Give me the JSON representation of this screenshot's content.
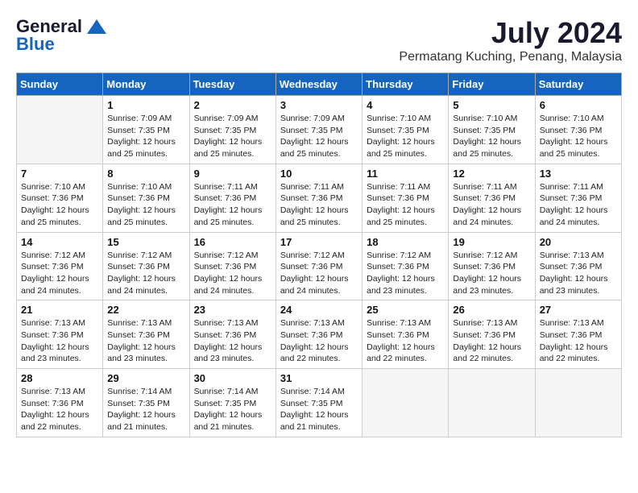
{
  "header": {
    "logo_general": "General",
    "logo_blue": "Blue",
    "month_year": "July 2024",
    "location": "Permatang Kuching, Penang, Malaysia"
  },
  "weekdays": [
    "Sunday",
    "Monday",
    "Tuesday",
    "Wednesday",
    "Thursday",
    "Friday",
    "Saturday"
  ],
  "weeks": [
    [
      {
        "day": "",
        "empty": true
      },
      {
        "day": "1",
        "sunrise": "7:09 AM",
        "sunset": "7:35 PM",
        "daylight": "12 hours and 25 minutes."
      },
      {
        "day": "2",
        "sunrise": "7:09 AM",
        "sunset": "7:35 PM",
        "daylight": "12 hours and 25 minutes."
      },
      {
        "day": "3",
        "sunrise": "7:09 AM",
        "sunset": "7:35 PM",
        "daylight": "12 hours and 25 minutes."
      },
      {
        "day": "4",
        "sunrise": "7:10 AM",
        "sunset": "7:35 PM",
        "daylight": "12 hours and 25 minutes."
      },
      {
        "day": "5",
        "sunrise": "7:10 AM",
        "sunset": "7:35 PM",
        "daylight": "12 hours and 25 minutes."
      },
      {
        "day": "6",
        "sunrise": "7:10 AM",
        "sunset": "7:36 PM",
        "daylight": "12 hours and 25 minutes."
      }
    ],
    [
      {
        "day": "7",
        "sunrise": "7:10 AM",
        "sunset": "7:36 PM",
        "daylight": "12 hours and 25 minutes."
      },
      {
        "day": "8",
        "sunrise": "7:10 AM",
        "sunset": "7:36 PM",
        "daylight": "12 hours and 25 minutes."
      },
      {
        "day": "9",
        "sunrise": "7:11 AM",
        "sunset": "7:36 PM",
        "daylight": "12 hours and 25 minutes."
      },
      {
        "day": "10",
        "sunrise": "7:11 AM",
        "sunset": "7:36 PM",
        "daylight": "12 hours and 25 minutes."
      },
      {
        "day": "11",
        "sunrise": "7:11 AM",
        "sunset": "7:36 PM",
        "daylight": "12 hours and 25 minutes."
      },
      {
        "day": "12",
        "sunrise": "7:11 AM",
        "sunset": "7:36 PM",
        "daylight": "12 hours and 24 minutes."
      },
      {
        "day": "13",
        "sunrise": "7:11 AM",
        "sunset": "7:36 PM",
        "daylight": "12 hours and 24 minutes."
      }
    ],
    [
      {
        "day": "14",
        "sunrise": "7:12 AM",
        "sunset": "7:36 PM",
        "daylight": "12 hours and 24 minutes."
      },
      {
        "day": "15",
        "sunrise": "7:12 AM",
        "sunset": "7:36 PM",
        "daylight": "12 hours and 24 minutes."
      },
      {
        "day": "16",
        "sunrise": "7:12 AM",
        "sunset": "7:36 PM",
        "daylight": "12 hours and 24 minutes."
      },
      {
        "day": "17",
        "sunrise": "7:12 AM",
        "sunset": "7:36 PM",
        "daylight": "12 hours and 24 minutes."
      },
      {
        "day": "18",
        "sunrise": "7:12 AM",
        "sunset": "7:36 PM",
        "daylight": "12 hours and 23 minutes."
      },
      {
        "day": "19",
        "sunrise": "7:12 AM",
        "sunset": "7:36 PM",
        "daylight": "12 hours and 23 minutes."
      },
      {
        "day": "20",
        "sunrise": "7:13 AM",
        "sunset": "7:36 PM",
        "daylight": "12 hours and 23 minutes."
      }
    ],
    [
      {
        "day": "21",
        "sunrise": "7:13 AM",
        "sunset": "7:36 PM",
        "daylight": "12 hours and 23 minutes."
      },
      {
        "day": "22",
        "sunrise": "7:13 AM",
        "sunset": "7:36 PM",
        "daylight": "12 hours and 23 minutes."
      },
      {
        "day": "23",
        "sunrise": "7:13 AM",
        "sunset": "7:36 PM",
        "daylight": "12 hours and 23 minutes."
      },
      {
        "day": "24",
        "sunrise": "7:13 AM",
        "sunset": "7:36 PM",
        "daylight": "12 hours and 22 minutes."
      },
      {
        "day": "25",
        "sunrise": "7:13 AM",
        "sunset": "7:36 PM",
        "daylight": "12 hours and 22 minutes."
      },
      {
        "day": "26",
        "sunrise": "7:13 AM",
        "sunset": "7:36 PM",
        "daylight": "12 hours and 22 minutes."
      },
      {
        "day": "27",
        "sunrise": "7:13 AM",
        "sunset": "7:36 PM",
        "daylight": "12 hours and 22 minutes."
      }
    ],
    [
      {
        "day": "28",
        "sunrise": "7:13 AM",
        "sunset": "7:36 PM",
        "daylight": "12 hours and 22 minutes."
      },
      {
        "day": "29",
        "sunrise": "7:14 AM",
        "sunset": "7:35 PM",
        "daylight": "12 hours and 21 minutes."
      },
      {
        "day": "30",
        "sunrise": "7:14 AM",
        "sunset": "7:35 PM",
        "daylight": "12 hours and 21 minutes."
      },
      {
        "day": "31",
        "sunrise": "7:14 AM",
        "sunset": "7:35 PM",
        "daylight": "12 hours and 21 minutes."
      },
      {
        "day": "",
        "empty": true
      },
      {
        "day": "",
        "empty": true
      },
      {
        "day": "",
        "empty": true
      }
    ]
  ]
}
